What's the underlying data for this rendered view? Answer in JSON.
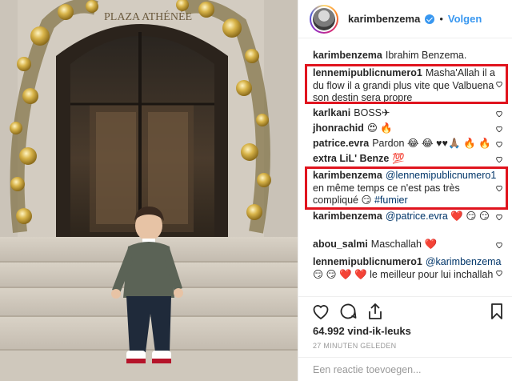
{
  "header": {
    "username": "karimbenzema",
    "separator": "•",
    "follow_label": "Volgen"
  },
  "comments": [
    {
      "user": "karimbenzema",
      "text": "Ibrahim Benzema.",
      "has_heart": false
    },
    {
      "user": "lennemipublicnumero1",
      "text": "Masha'Allah il a du flow il a grandi plus vite que Valbuena son destin sera propre",
      "has_heart": true,
      "highlighted": true
    },
    {
      "user": "karlkani",
      "text": "BOSS✈",
      "has_heart": true
    },
    {
      "user": "jhonrachid",
      "text": "😍 🔥",
      "has_heart": true
    },
    {
      "user": "patrice.evra",
      "text": "Pardon 😂 😂 ♥♥🙏🏽 🔥 🔥",
      "has_heart": true
    },
    {
      "user": "extra LiL' Benze",
      "text": "💯",
      "has_heart": true
    },
    {
      "user": "karimbenzema",
      "mention": "@lennemipublicnumero1",
      "text": " en même temps ce n'est pas très compliqué 😏 ",
      "hashtag": "#fumier",
      "has_heart": true,
      "highlighted": true
    },
    {
      "user": "karimbenzema",
      "mention": "@patrice.evra",
      "text": " ❤️ 😏 😏",
      "has_heart": true
    },
    {
      "user": "abou_salmi",
      "text": "Maschallah ❤️",
      "has_heart": true
    },
    {
      "user": "lennemipublicnumero1",
      "mention": "@karimbenzema",
      "text": " 😏 😏 ❤️ ❤️ le meilleur pour lui inchallah",
      "has_heart": true
    }
  ],
  "actions": {
    "icons": [
      "heart-icon",
      "comment-icon",
      "share-icon",
      "bookmark-icon"
    ]
  },
  "likes": "64.992 vind-ik-leuks",
  "timestamp": "27 MINUTEN GELEDEN",
  "add_comment": {
    "placeholder": "Een reactie toevoegen..."
  },
  "colors": {
    "link": "#3897f0",
    "highlight_box": "#e0141e",
    "mention": "#003569"
  }
}
